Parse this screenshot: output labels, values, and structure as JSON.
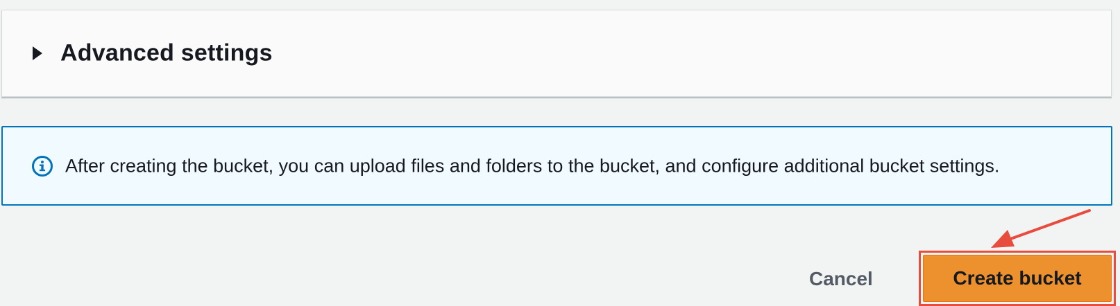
{
  "advanced_settings": {
    "title": "Advanced settings",
    "expanded": false,
    "caret_icon": "caret-right-icon"
  },
  "info_alert": {
    "icon": "info-icon",
    "message": "After creating the bucket, you can upload files and folders to the bucket, and configure additional bucket settings."
  },
  "footer": {
    "cancel_label": "Cancel",
    "create_label": "Create bucket"
  },
  "colors": {
    "primary_button": "#ec912d",
    "info_border": "#0073bb",
    "annotation": "#e74c3c"
  }
}
